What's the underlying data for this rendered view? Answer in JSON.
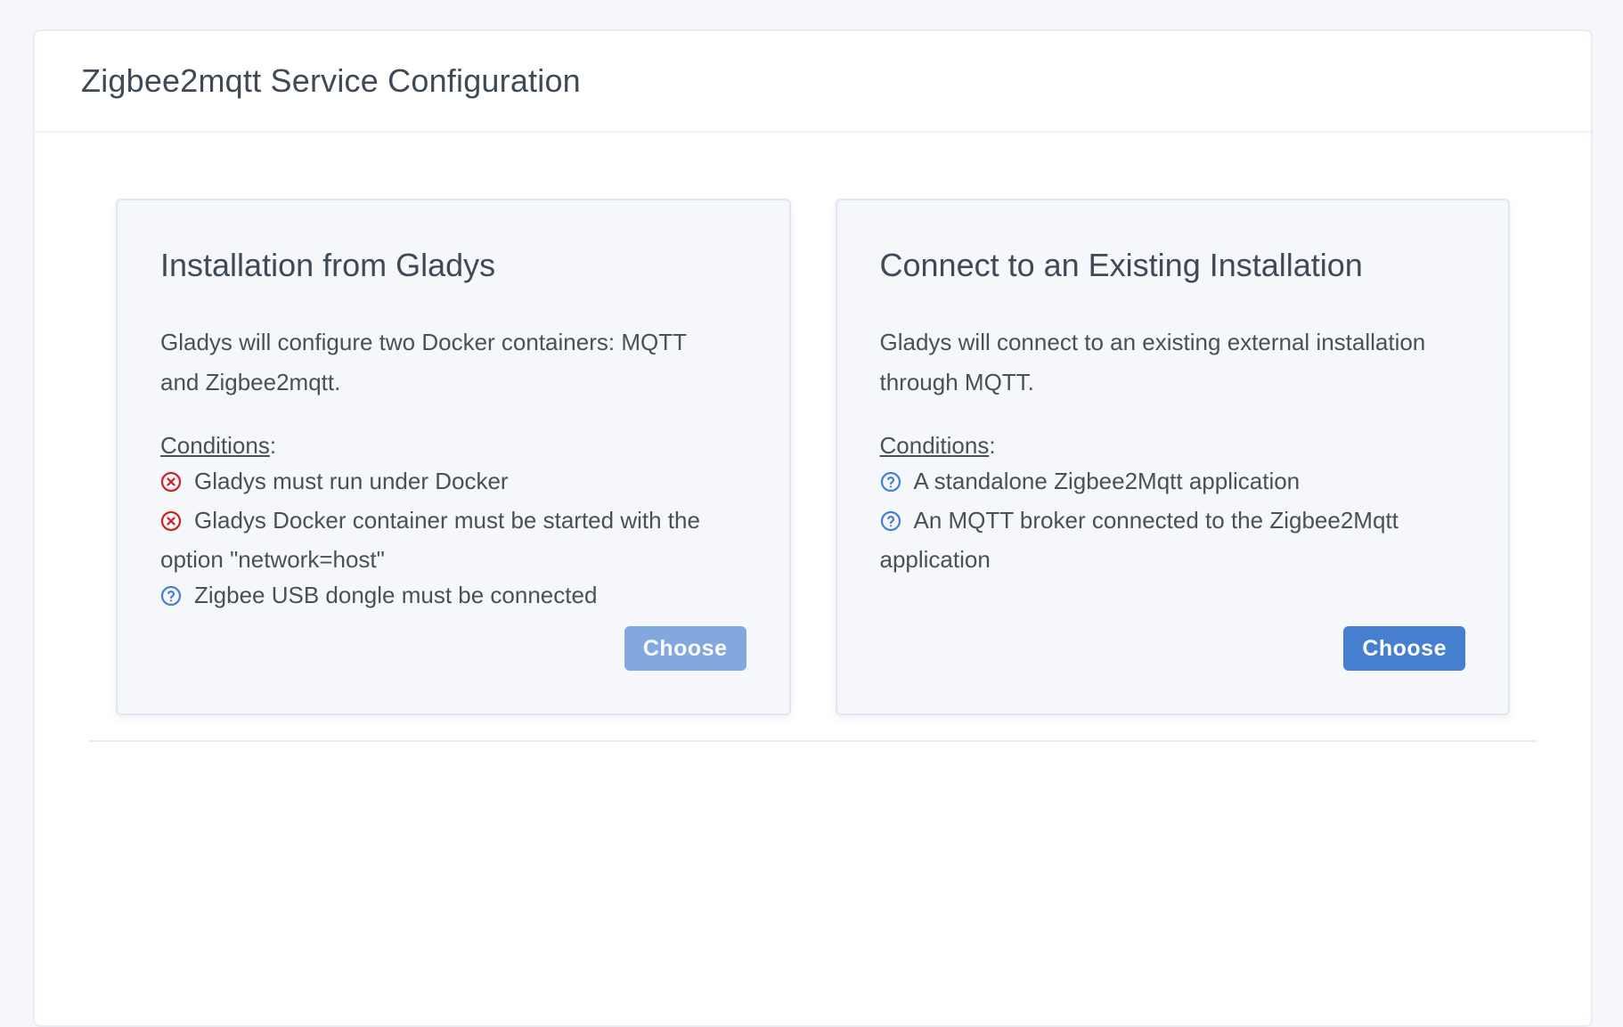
{
  "header": {
    "title": "Zigbee2mqtt Service Configuration"
  },
  "colors": {
    "page_background": "#f5f7fb",
    "card_background": "#ffffff",
    "option_card_background": "#f5f7fb",
    "primary_blue": "#467fcf",
    "error_red": "#cd201f",
    "text": "#495057"
  },
  "cards": [
    {
      "title": "Installation from Gladys",
      "description": "Gladys will configure two Docker containers: MQTT and Zigbee2mqtt.",
      "conditions_label": "Conditions",
      "conditions_suffix": ":",
      "conditions": [
        {
          "status": "error",
          "icon": "x-circle-icon",
          "text": "Gladys must run under Docker"
        },
        {
          "status": "error",
          "icon": "x-circle-icon",
          "text": "Gladys Docker container must be started with the option \"network=host\""
        },
        {
          "status": "unknown",
          "icon": "help-circle-icon",
          "text": "Zigbee USB dongle must be connected"
        }
      ],
      "button": {
        "label": "Choose",
        "enabled": false
      }
    },
    {
      "title": "Connect to an Existing Installation",
      "description": "Gladys will connect to an existing external installation through MQTT.",
      "conditions_label": "Conditions",
      "conditions_suffix": ":",
      "conditions": [
        {
          "status": "unknown",
          "icon": "help-circle-icon",
          "text": "A standalone Zigbee2Mqtt application"
        },
        {
          "status": "unknown",
          "icon": "help-circle-icon",
          "text": "An MQTT broker connected to the Zigbee2Mqtt application"
        }
      ],
      "button": {
        "label": "Choose",
        "enabled": true
      }
    }
  ]
}
